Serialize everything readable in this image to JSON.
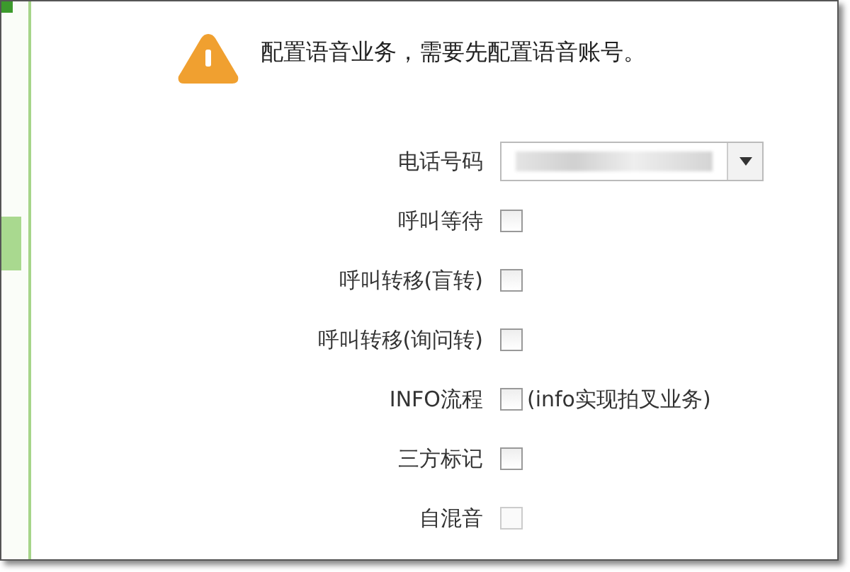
{
  "notice": {
    "text": "配置语音业务，需要先配置语音账号。"
  },
  "fields": [
    {
      "kind": "select",
      "label": "电话号码"
    },
    {
      "kind": "checkbox",
      "label": "呼叫等待",
      "checked": false,
      "disabled": false
    },
    {
      "kind": "checkbox",
      "label": "呼叫转移(盲转)",
      "checked": false,
      "disabled": false
    },
    {
      "kind": "checkbox",
      "label": "呼叫转移(询问转)",
      "checked": false,
      "disabled": false
    },
    {
      "kind": "checkbox",
      "label": "INFO流程",
      "checked": false,
      "disabled": false,
      "note": "(info实现拍叉业务)"
    },
    {
      "kind": "checkbox",
      "label": "三方标记",
      "checked": false,
      "disabled": false
    },
    {
      "kind": "checkbox",
      "label": "自混音",
      "checked": false,
      "disabled": true
    }
  ]
}
